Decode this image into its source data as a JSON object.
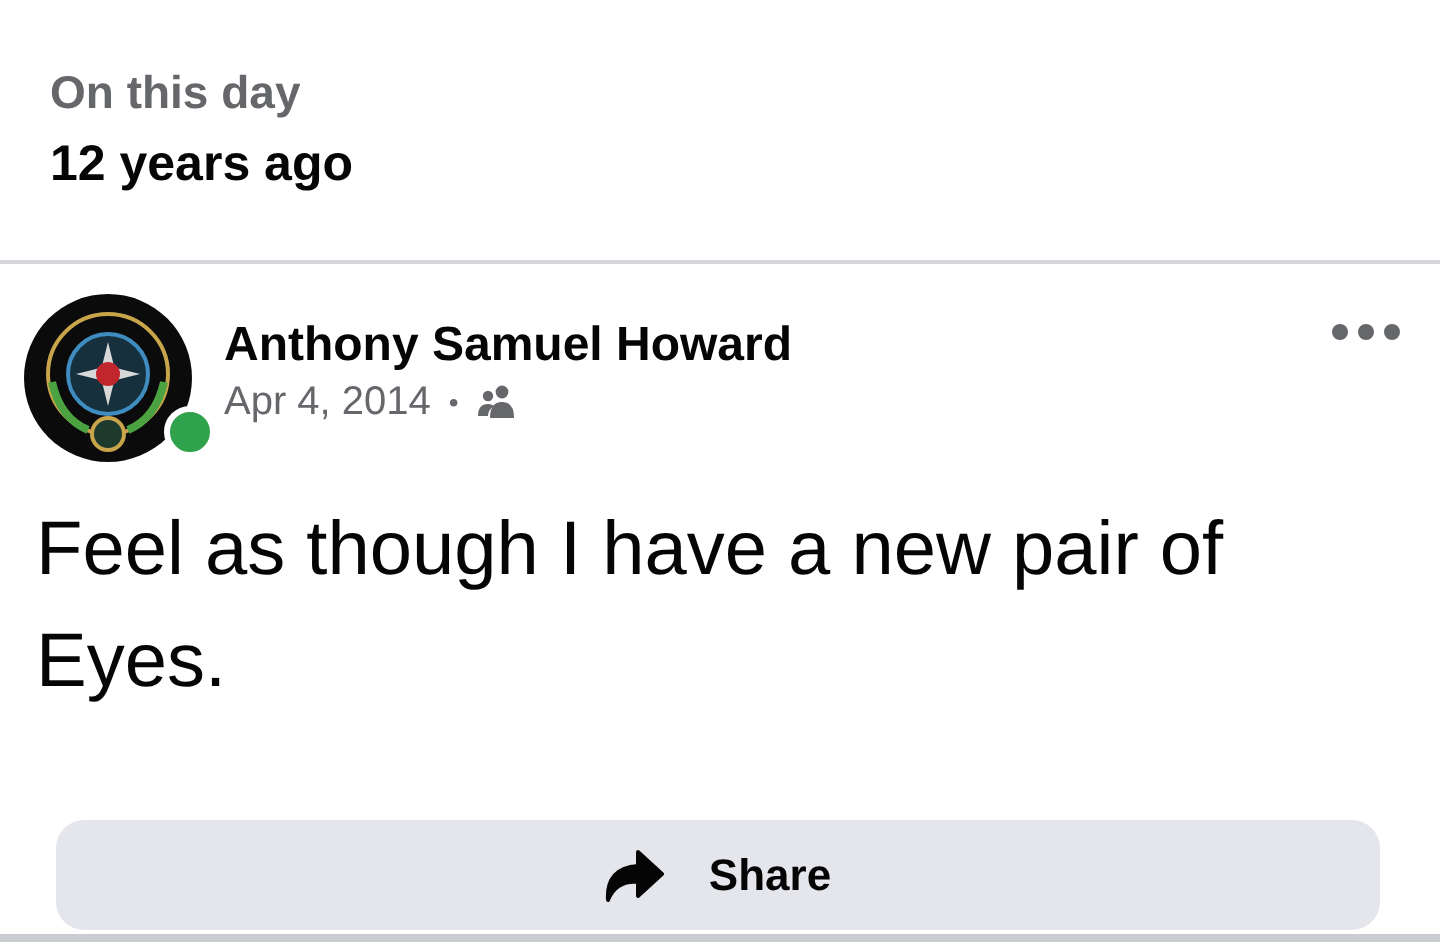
{
  "memory": {
    "title": "On this day",
    "subtitle": "12 years ago"
  },
  "post": {
    "author": "Anthony Samuel Howard",
    "online": true,
    "date": "Apr 4, 2014",
    "separator": "•",
    "audience_icon": {
      "kind": "friends"
    },
    "text": "Feel as though I have a new pair of Eyes."
  },
  "actions": [
    {
      "label": "Share",
      "kind": "share"
    }
  ]
}
